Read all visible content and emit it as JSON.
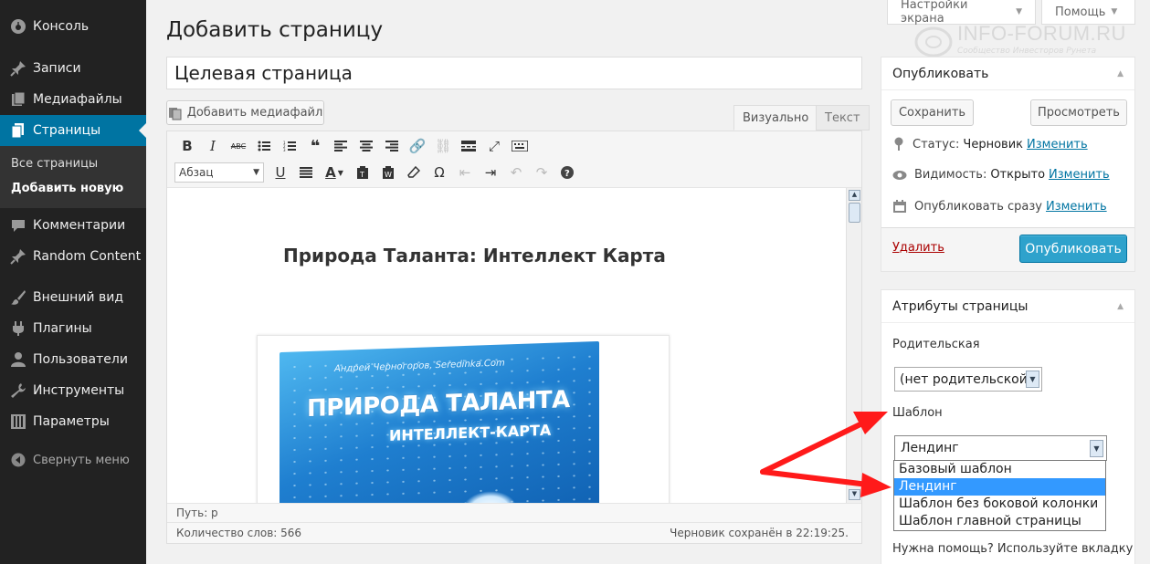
{
  "sidebar": {
    "items": [
      {
        "label": "Консоль",
        "icon": "dashboard-icon"
      },
      {
        "label": "Записи",
        "icon": "pin-icon"
      },
      {
        "label": "Медиафайлы",
        "icon": "media-icon"
      },
      {
        "label": "Страницы",
        "icon": "pages-icon"
      },
      {
        "label": "Комментарии",
        "icon": "comment-icon"
      },
      {
        "label": "Random Content",
        "icon": "pin-icon"
      },
      {
        "label": "Внешний вид",
        "icon": "brush-icon"
      },
      {
        "label": "Плагины",
        "icon": "plugin-icon"
      },
      {
        "label": "Пользователи",
        "icon": "users-icon"
      },
      {
        "label": "Инструменты",
        "icon": "wrench-icon"
      },
      {
        "label": "Параметры",
        "icon": "settings-icon"
      }
    ],
    "submenu": [
      "Все страницы",
      "Добавить новую"
    ],
    "collapse": "Свернуть меню"
  },
  "top": {
    "screen_options": "Настройки экрана",
    "help": "Помощь"
  },
  "watermark": {
    "title": "INFO-FORUM.RU",
    "subtitle": "Сообщество Инвесторов Рунета"
  },
  "page_title": "Добавить страницу",
  "post_title": "Целевая страница",
  "editor": {
    "add_media": "Добавить медиафайл",
    "tab_visual": "Визуально",
    "tab_text": "Текст",
    "format_select": "Абзац",
    "heading": "Природа Таланта: Интеллект Карта",
    "book": {
      "author": "Андрей Черногоров, Seredinka.Com",
      "title": "ПРИРОДА ТАЛАНТА",
      "subtitle": "ИНТЕЛЛЕКТ-КАРТА"
    },
    "path": "Путь: p",
    "word_count": "Количество слов: 566",
    "saved": "Черновик сохранён в 22:19:25."
  },
  "publish": {
    "title": "Опубликовать",
    "save": "Сохранить",
    "preview": "Просмотреть",
    "status_label": "Статус:",
    "status_value": "Черновик",
    "visibility_label": "Видимость:",
    "visibility_value": "Открыто",
    "publish_label": "Опубликовать сразу",
    "change": "Изменить",
    "delete": "Удалить",
    "publish_button": "Опубликовать"
  },
  "attributes": {
    "title": "Атрибуты страницы",
    "parent_label": "Родительская",
    "parent_value": "(нет родительской)",
    "template_label": "Шаблон",
    "template_value": "Лендинг",
    "template_options": [
      "Базовый шаблон",
      "Лендинг",
      "Шаблон без боковой колонки",
      "Шаблон главной страницы"
    ],
    "help_text": "Нужна помощь? Используйте вкладку"
  },
  "colors": {
    "accent": "#0074a2",
    "annotation_arrow": "#ff1a1a"
  }
}
